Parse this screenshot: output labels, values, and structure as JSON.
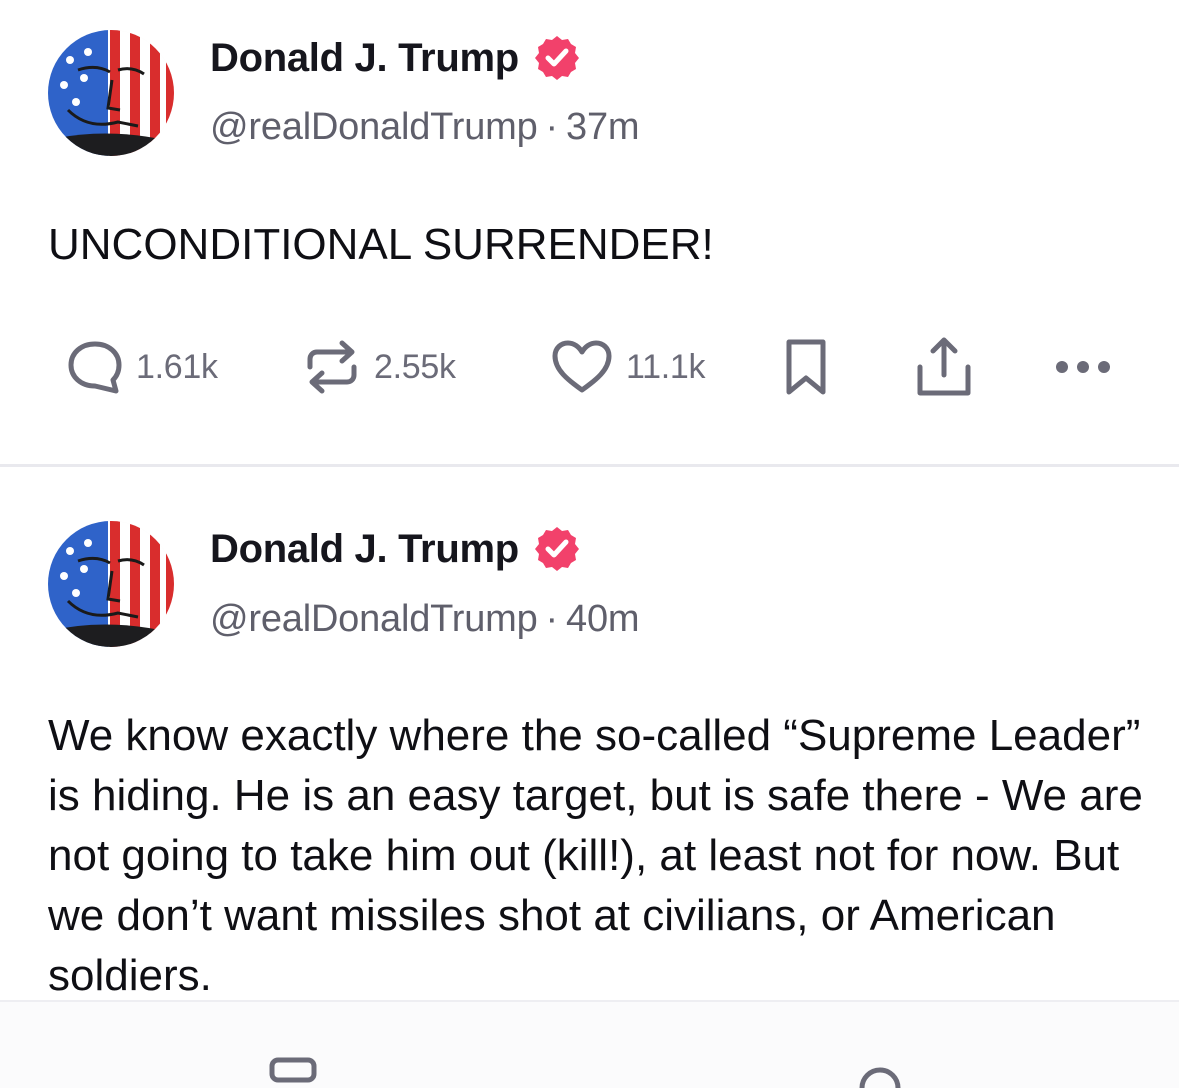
{
  "posts": [
    {
      "author": {
        "display_name": "Donald J. Trump",
        "handle": "@realDonaldTrump",
        "verified": true,
        "avatar_icon": "flag-painted-portrait-avatar"
      },
      "time_ago": "37m",
      "text": "UNCONDITIONAL SURRENDER!",
      "actions": {
        "replies": "1.61k",
        "retruths": "2.55k",
        "likes": "11.1k"
      }
    },
    {
      "author": {
        "display_name": "Donald J. Trump",
        "handle": "@realDonaldTrump",
        "verified": true,
        "avatar_icon": "flag-painted-portrait-avatar"
      },
      "time_ago": "40m",
      "text": "We know exactly where the so-called “Supreme Leader” is hiding. He is an easy target, but is safe there - We are not going to take him out (kill!), at least not for now. But we don’t want missiles shot at civilians, or American soldiers."
    }
  ],
  "colors": {
    "verified_badge": "#f2416b",
    "action_icon": "#6b6b78",
    "meta_text": "#5f5f6b",
    "divider": "#e9e9ee"
  },
  "system_nav": {
    "icons": [
      "recents-icon",
      "home-icon"
    ]
  }
}
